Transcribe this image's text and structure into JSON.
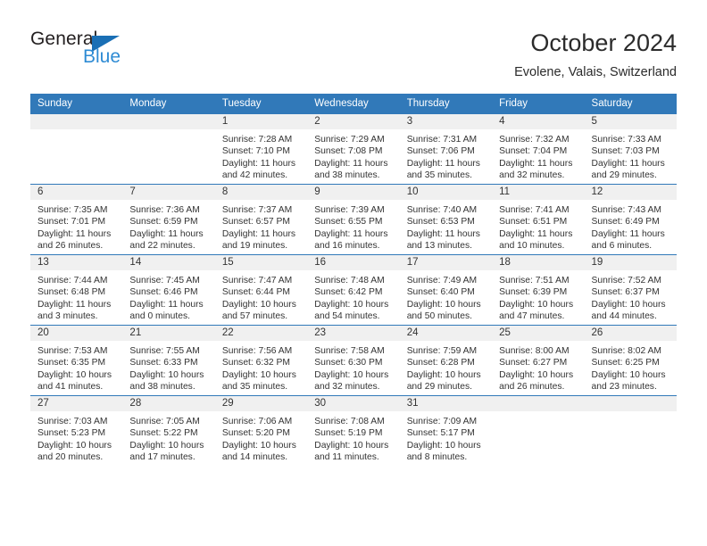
{
  "brand": {
    "name_top": "General",
    "name_bottom": "Blue",
    "triangle_color": "#1a6fb5",
    "blue_text_color": "#2e8bd4"
  },
  "header": {
    "month_title": "October 2024",
    "location": "Evolene, Valais, Switzerland"
  },
  "theme": {
    "header_blue": "#3179b9",
    "daynum_strip": "#f0f0f0",
    "text": "#333333"
  },
  "calendar": {
    "weekday_headers": [
      "Sunday",
      "Monday",
      "Tuesday",
      "Wednesday",
      "Thursday",
      "Friday",
      "Saturday"
    ],
    "weeks": [
      [
        {
          "day": "",
          "details": ""
        },
        {
          "day": "",
          "details": ""
        },
        {
          "day": "1",
          "details": "Sunrise: 7:28 AM\nSunset: 7:10 PM\nDaylight: 11 hours\nand 42 minutes."
        },
        {
          "day": "2",
          "details": "Sunrise: 7:29 AM\nSunset: 7:08 PM\nDaylight: 11 hours\nand 38 minutes."
        },
        {
          "day": "3",
          "details": "Sunrise: 7:31 AM\nSunset: 7:06 PM\nDaylight: 11 hours\nand 35 minutes."
        },
        {
          "day": "4",
          "details": "Sunrise: 7:32 AM\nSunset: 7:04 PM\nDaylight: 11 hours\nand 32 minutes."
        },
        {
          "day": "5",
          "details": "Sunrise: 7:33 AM\nSunset: 7:03 PM\nDaylight: 11 hours\nand 29 minutes."
        }
      ],
      [
        {
          "day": "6",
          "details": "Sunrise: 7:35 AM\nSunset: 7:01 PM\nDaylight: 11 hours\nand 26 minutes."
        },
        {
          "day": "7",
          "details": "Sunrise: 7:36 AM\nSunset: 6:59 PM\nDaylight: 11 hours\nand 22 minutes."
        },
        {
          "day": "8",
          "details": "Sunrise: 7:37 AM\nSunset: 6:57 PM\nDaylight: 11 hours\nand 19 minutes."
        },
        {
          "day": "9",
          "details": "Sunrise: 7:39 AM\nSunset: 6:55 PM\nDaylight: 11 hours\nand 16 minutes."
        },
        {
          "day": "10",
          "details": "Sunrise: 7:40 AM\nSunset: 6:53 PM\nDaylight: 11 hours\nand 13 minutes."
        },
        {
          "day": "11",
          "details": "Sunrise: 7:41 AM\nSunset: 6:51 PM\nDaylight: 11 hours\nand 10 minutes."
        },
        {
          "day": "12",
          "details": "Sunrise: 7:43 AM\nSunset: 6:49 PM\nDaylight: 11 hours\nand 6 minutes."
        }
      ],
      [
        {
          "day": "13",
          "details": "Sunrise: 7:44 AM\nSunset: 6:48 PM\nDaylight: 11 hours\nand 3 minutes."
        },
        {
          "day": "14",
          "details": "Sunrise: 7:45 AM\nSunset: 6:46 PM\nDaylight: 11 hours\nand 0 minutes."
        },
        {
          "day": "15",
          "details": "Sunrise: 7:47 AM\nSunset: 6:44 PM\nDaylight: 10 hours\nand 57 minutes."
        },
        {
          "day": "16",
          "details": "Sunrise: 7:48 AM\nSunset: 6:42 PM\nDaylight: 10 hours\nand 54 minutes."
        },
        {
          "day": "17",
          "details": "Sunrise: 7:49 AM\nSunset: 6:40 PM\nDaylight: 10 hours\nand 50 minutes."
        },
        {
          "day": "18",
          "details": "Sunrise: 7:51 AM\nSunset: 6:39 PM\nDaylight: 10 hours\nand 47 minutes."
        },
        {
          "day": "19",
          "details": "Sunrise: 7:52 AM\nSunset: 6:37 PM\nDaylight: 10 hours\nand 44 minutes."
        }
      ],
      [
        {
          "day": "20",
          "details": "Sunrise: 7:53 AM\nSunset: 6:35 PM\nDaylight: 10 hours\nand 41 minutes."
        },
        {
          "day": "21",
          "details": "Sunrise: 7:55 AM\nSunset: 6:33 PM\nDaylight: 10 hours\nand 38 minutes."
        },
        {
          "day": "22",
          "details": "Sunrise: 7:56 AM\nSunset: 6:32 PM\nDaylight: 10 hours\nand 35 minutes."
        },
        {
          "day": "23",
          "details": "Sunrise: 7:58 AM\nSunset: 6:30 PM\nDaylight: 10 hours\nand 32 minutes."
        },
        {
          "day": "24",
          "details": "Sunrise: 7:59 AM\nSunset: 6:28 PM\nDaylight: 10 hours\nand 29 minutes."
        },
        {
          "day": "25",
          "details": "Sunrise: 8:00 AM\nSunset: 6:27 PM\nDaylight: 10 hours\nand 26 minutes."
        },
        {
          "day": "26",
          "details": "Sunrise: 8:02 AM\nSunset: 6:25 PM\nDaylight: 10 hours\nand 23 minutes."
        }
      ],
      [
        {
          "day": "27",
          "details": "Sunrise: 7:03 AM\nSunset: 5:23 PM\nDaylight: 10 hours\nand 20 minutes."
        },
        {
          "day": "28",
          "details": "Sunrise: 7:05 AM\nSunset: 5:22 PM\nDaylight: 10 hours\nand 17 minutes."
        },
        {
          "day": "29",
          "details": "Sunrise: 7:06 AM\nSunset: 5:20 PM\nDaylight: 10 hours\nand 14 minutes."
        },
        {
          "day": "30",
          "details": "Sunrise: 7:08 AM\nSunset: 5:19 PM\nDaylight: 10 hours\nand 11 minutes."
        },
        {
          "day": "31",
          "details": "Sunrise: 7:09 AM\nSunset: 5:17 PM\nDaylight: 10 hours\nand 8 minutes."
        },
        {
          "day": "",
          "details": ""
        },
        {
          "day": "",
          "details": ""
        }
      ]
    ]
  }
}
